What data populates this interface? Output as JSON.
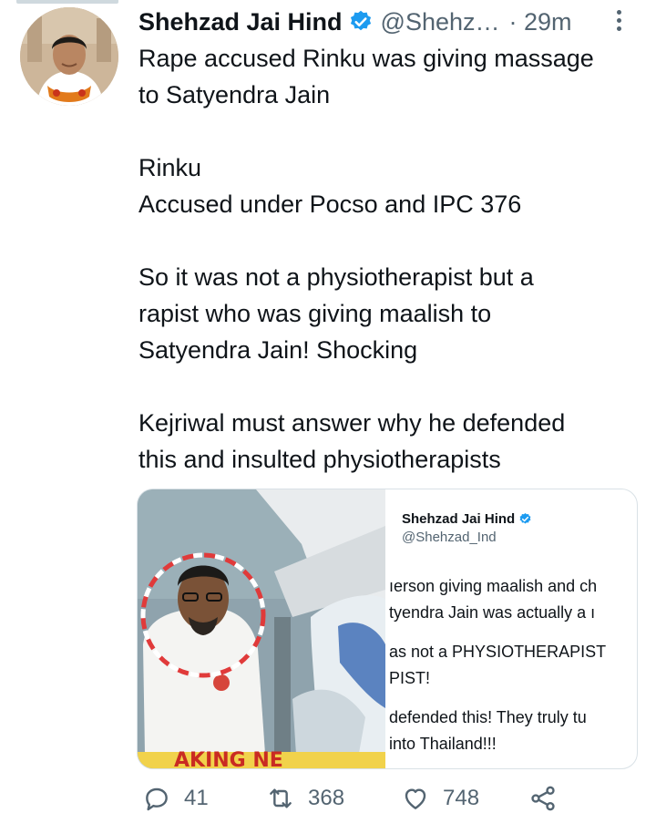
{
  "tweet": {
    "author_name": "Shehzad Jai Hind",
    "handle": "@Shehz…",
    "time": "· 29m",
    "paragraphs": [
      [
        "Rape accused Rinku was giving massage",
        "to Satyendra Jain"
      ],
      [
        "Rinku",
        "Accused under Pocso and IPC 376"
      ],
      [
        "So it was not a physiotherapist but a",
        "rapist who was giving maalish to",
        "Satyendra Jain! Shocking"
      ],
      [
        "Kejriwal must answer why he defended",
        "this and insulted physiotherapists"
      ]
    ]
  },
  "quote": {
    "author_name": "Shehzad Jai Hind",
    "handle": "@Shehzad_Ind",
    "lines": [
      "ıerson giving maalish and ch",
      "tyendra Jain was actually a ı",
      "as not a PHYSIOTHERAPIST",
      "PIST!",
      "defended this! They truly tu",
      "into Thailand!!!"
    ],
    "image_caption": "AKING NE"
  },
  "actions": {
    "replies": "41",
    "retweets": "368",
    "likes": "748"
  },
  "icons": [
    "verified-badge-icon",
    "more-icon",
    "reply-icon",
    "retweet-icon",
    "like-icon",
    "share-icon"
  ],
  "colors": {
    "verified": "#1d9bf0",
    "text": "#0f1419",
    "secondary": "#536471"
  }
}
